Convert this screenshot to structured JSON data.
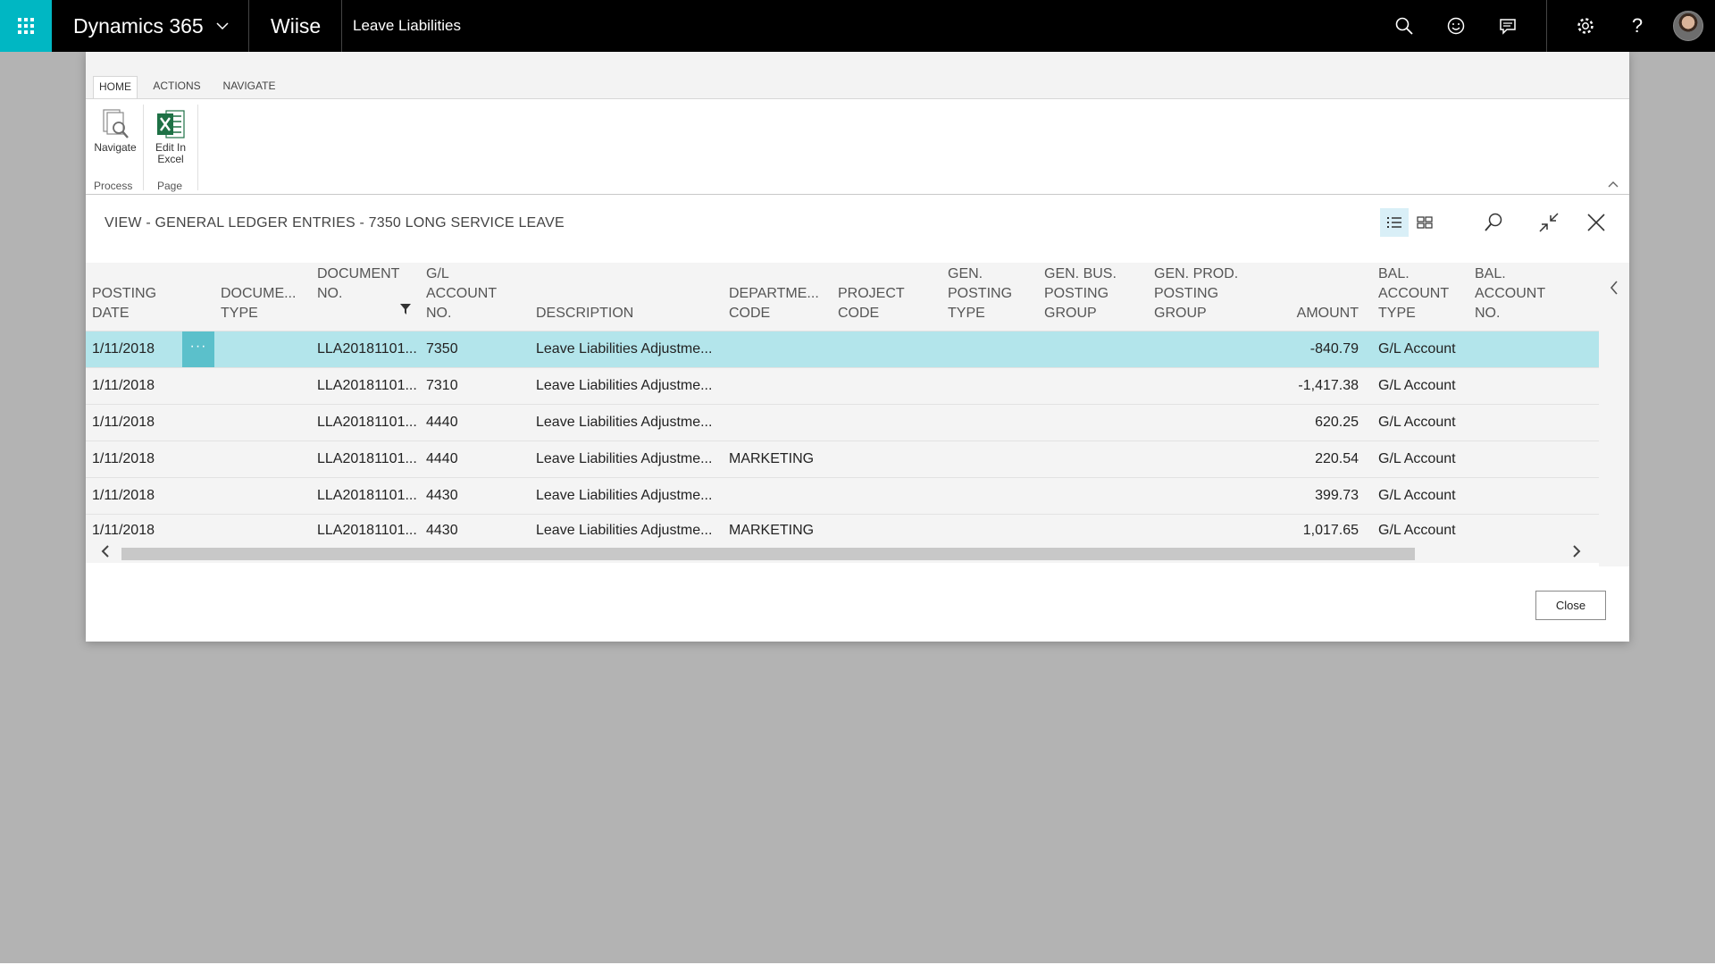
{
  "topbar": {
    "app_name": "Dynamics 365",
    "company": "Wiise",
    "page": "Leave Liabilities",
    "icons": [
      "app-launcher-icon",
      "chevron-down-icon",
      "search-icon",
      "smiley-icon",
      "feedback-icon",
      "settings-icon",
      "help-icon",
      "user-avatar"
    ],
    "accent_color": "#00b7c3"
  },
  "ribbon": {
    "tabs": [
      "HOME",
      "ACTIONS",
      "NAVIGATE"
    ],
    "active_tab": "HOME",
    "buttons": {
      "navigate": "Navigate",
      "edit_in_excel": "Edit In Excel"
    },
    "groups": {
      "process": "Process",
      "page": "Page"
    }
  },
  "view": {
    "title": "VIEW - GENERAL LEDGER ENTRIES - 7350 LONG SERVICE LEAVE"
  },
  "grid": {
    "columns": {
      "posting_date": "POSTING\nDATE",
      "document_type": "DOCUME...\nTYPE",
      "document_no": "DOCUMENT\nNO.",
      "gl_account_no": "G/L\nACCOUNT\nNO.",
      "description": "DESCRIPTION",
      "department_code": "DEPARTME...\nCODE",
      "project_code": "PROJECT\nCODE",
      "gen_posting_type": "GEN.\nPOSTING\nTYPE",
      "gen_bus_posting_group": "GEN. BUS.\nPOSTING\nGROUP",
      "gen_prod_posting_group": "GEN. PROD.\nPOSTING\nGROUP",
      "amount": "AMOUNT",
      "bal_account_type": "BAL.\nACCOUNT\nTYPE",
      "bal_account_no": "BAL.\nACCOUNT\nNO."
    },
    "filtered_column": "document_no",
    "rows": [
      {
        "posting_date": "1/11/2018",
        "document_no": "LLA20181101...",
        "gl_account_no": "7350",
        "description": "Leave Liabilities Adjustme...",
        "department_code": "",
        "amount": "-840.79",
        "bal_account_type": "G/L Account"
      },
      {
        "posting_date": "1/11/2018",
        "document_no": "LLA20181101...",
        "gl_account_no": "7310",
        "description": "Leave Liabilities Adjustme...",
        "department_code": "",
        "amount": "-1,417.38",
        "bal_account_type": "G/L Account"
      },
      {
        "posting_date": "1/11/2018",
        "document_no": "LLA20181101...",
        "gl_account_no": "4440",
        "description": "Leave Liabilities Adjustme...",
        "department_code": "",
        "amount": "620.25",
        "bal_account_type": "G/L Account"
      },
      {
        "posting_date": "1/11/2018",
        "document_no": "LLA20181101...",
        "gl_account_no": "4440",
        "description": "Leave Liabilities Adjustme...",
        "department_code": "MARKETING",
        "amount": "220.54",
        "bal_account_type": "G/L Account"
      },
      {
        "posting_date": "1/11/2018",
        "document_no": "LLA20181101...",
        "gl_account_no": "4430",
        "description": "Leave Liabilities Adjustme...",
        "department_code": "",
        "amount": "399.73",
        "bal_account_type": "G/L Account"
      },
      {
        "posting_date": "1/11/2018",
        "document_no": "LLA20181101...",
        "gl_account_no": "4430",
        "description": "Leave Liabilities Adjustme...",
        "department_code": "MARKETING",
        "amount": "1,017.65",
        "bal_account_type": "G/L Account"
      }
    ],
    "row_menu_glyph": "···",
    "selected_row_color": "#b3e5eb"
  },
  "footer": {
    "close_label": "Close"
  }
}
